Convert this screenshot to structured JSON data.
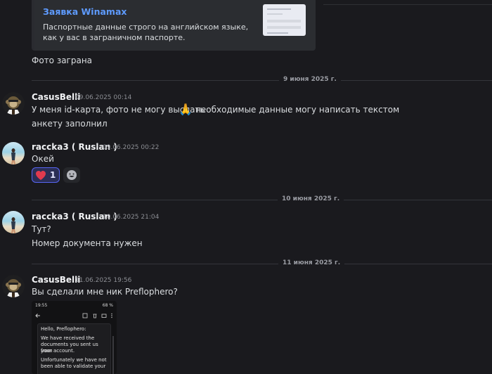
{
  "embed": {
    "title": "Заявка Winamax",
    "description": "Паспортные данные строго на английском языке, как у вас в заграничном паспорте."
  },
  "photo_caption": "Фото заграна",
  "dividers": [
    "9 июня 2025 г.",
    "10 июня 2025 г.",
    "11 июня 2025 г."
  ],
  "messages": [
    {
      "user": "CasusBelli",
      "time": "09.06.2025 00:14",
      "lines": [
        "У меня id-карта, фото не могу выслать",
        "необходимые данные могу написать текстом",
        "анкету заполнил"
      ],
      "emoji": "🙏"
    },
    {
      "user": "raccka3 ( Ruslan )",
      "time": "09.06.2025 00:22",
      "lines": [
        "Окей"
      ],
      "reaction": {
        "emoji": "heart",
        "count": "1"
      }
    },
    {
      "user": "raccka3 ( Ruslan )",
      "time": "10.06.2025 21:04",
      "lines": [
        "Тут?",
        "Номер документа нужен"
      ]
    },
    {
      "user": "CasusBelli",
      "time": "11.06.2025 19:56",
      "lines": [
        "Вы сделали мне ник Preflophero?"
      ]
    }
  ],
  "attachment": {
    "status_time": "19:55",
    "status_right": "68 %",
    "mail_lines": [
      "Hello, Preflophero:",
      "We have received the",
      "documents you sent us from",
      "your account.",
      "Unfortunately we have not",
      "been able to validate your"
    ]
  },
  "colors": {
    "background": "#1a1a1e",
    "link": "#5e9bff",
    "reaction_border": "#5865f2",
    "heart": "#e03a4e"
  }
}
